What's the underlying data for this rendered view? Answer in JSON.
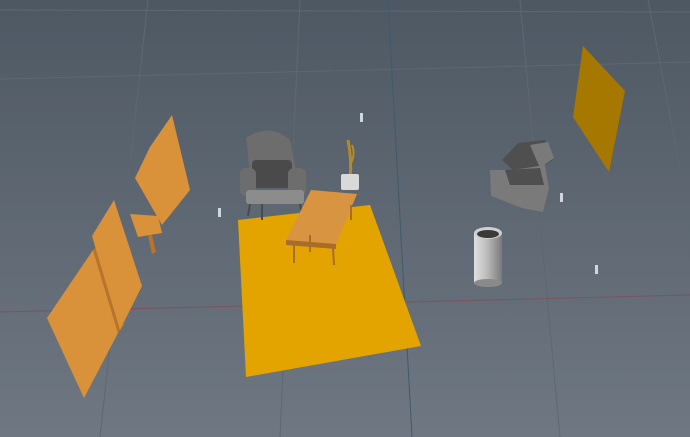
{
  "viewport": {
    "background_top": "#4e5863",
    "background_bottom": "#6f7882",
    "grid_color": "#5d6873",
    "axis_x_color": "#7a5460",
    "axis_z_color": "#3f5a6a"
  },
  "objects": {
    "rug": {
      "color": "#e3a400"
    },
    "panels": {
      "color": "#d9913a",
      "shade": "#b8742a"
    },
    "wall_panel_right": {
      "color": "#a77800"
    },
    "coffee_table": {
      "top": "#d89440",
      "legs": "#a86d2c"
    },
    "armchair": {
      "color": "#6d6d6d",
      "dark": "#4a4a4a",
      "light": "#8c8c8c"
    },
    "sofa_chair": {
      "color": "#7a7a7a",
      "dark": "#4f4f4f"
    },
    "plant_pot": {
      "pot": "#d9d9d9",
      "stem": "#b58a2a"
    },
    "trash_can": {
      "light": "#d0d0d0",
      "dark": "#3a3a3a"
    },
    "markers": {
      "color": "#cfd6dc"
    }
  }
}
